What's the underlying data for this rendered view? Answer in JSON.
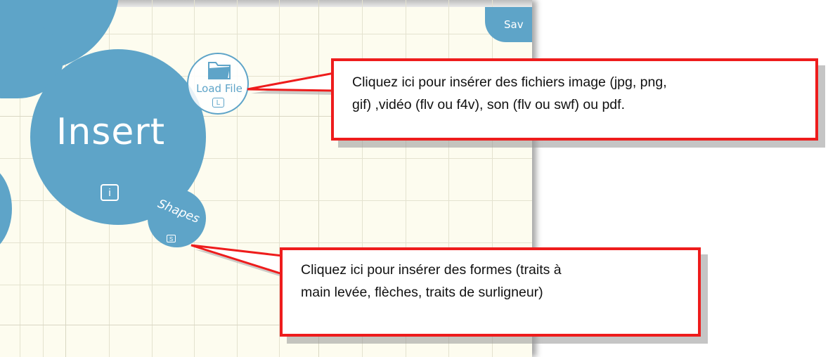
{
  "toolbar": {
    "insert_label": "Insert",
    "insert_shortcut": "i",
    "shapes_label": "Shapes",
    "shapes_shortcut": "S",
    "load_file_label": "Load File",
    "load_file_shortcut": "L",
    "save_label": "Sav"
  },
  "callouts": [
    {
      "line1": "Cliquez ici pour insérer des fichiers image (jpg, png,",
      "line2": "gif) ,vidéo (flv ou f4v), son (flv ou swf) ou  pdf."
    },
    {
      "line1": "Cliquez ici pour insérer des formes (traits à",
      "line2": "main levée, flèches, traits de surligneur)"
    }
  ],
  "colors": {
    "accent": "#5ea4c8",
    "callout_border": "#ee1c1c",
    "canvas_bg": "#fdfcef"
  },
  "icons": [
    "folder-icon"
  ]
}
